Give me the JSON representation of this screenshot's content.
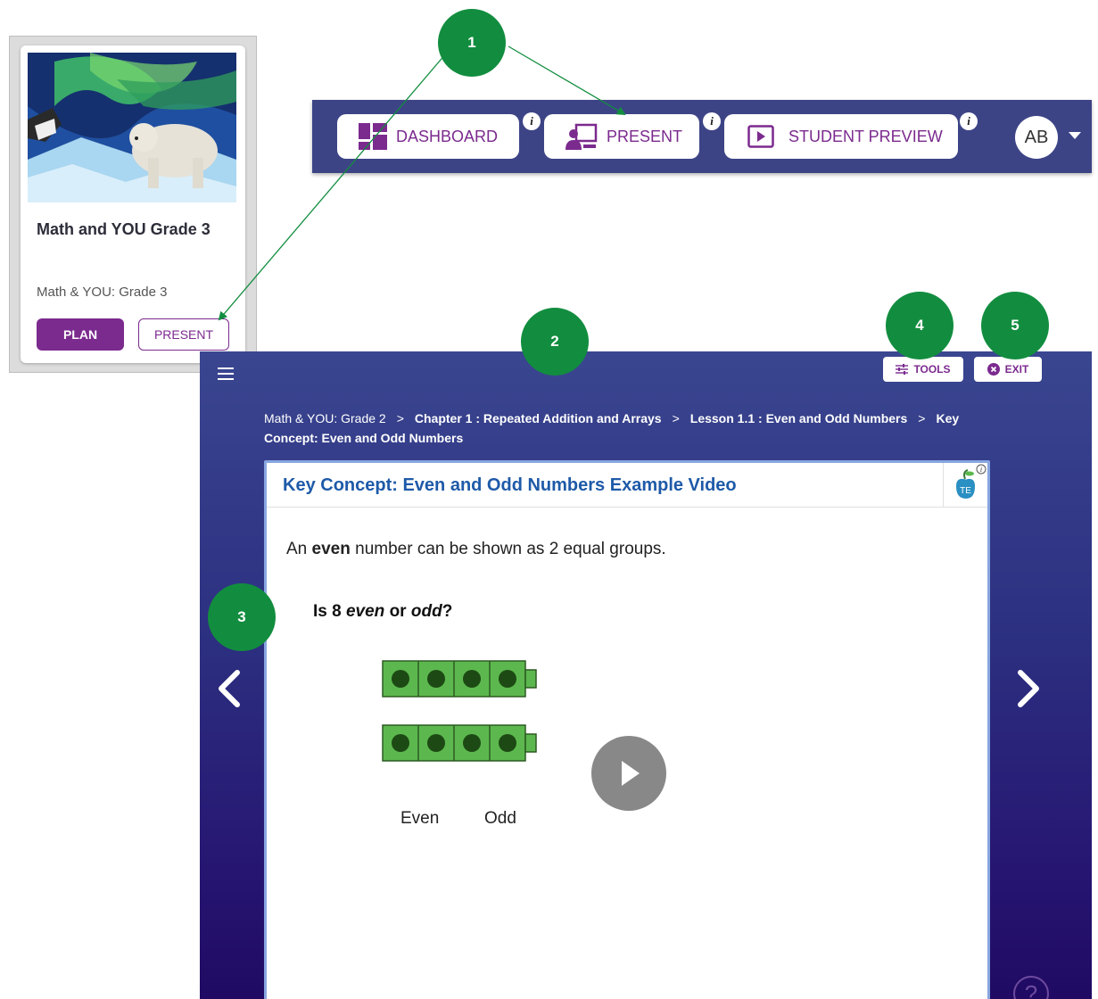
{
  "card": {
    "title": "Math and YOU Grade 3",
    "subtitle": "Math & YOU: Grade 3",
    "plan_label": "PLAN",
    "present_label": "PRESENT"
  },
  "navbar": {
    "dashboard_label": "DASHBOARD",
    "present_label": "PRESENT",
    "student_preview_label": "STUDENT PREVIEW",
    "info_glyph": "i",
    "avatar_initials": "AB"
  },
  "presenter": {
    "tools_label": "TOOLS",
    "exit_label": "EXIT",
    "breadcrumb": {
      "crumb1": "Math & YOU: Grade 2",
      "crumb2": "Chapter 1 : Repeated Addition and Arrays",
      "crumb3": "Lesson 1.1 : Even and Odd Numbers",
      "crumb4": "Key Concept: Even and Odd Numbers",
      "separator": ">"
    },
    "content": {
      "title": "Key Concept: Even and Odd Numbers Example Video",
      "te_label": "TE",
      "text_pre": "An ",
      "text_bold": "even",
      "text_post": " number can be shown as 2 equal groups.",
      "q_pre": "Is 8 ",
      "q_even": "even",
      "q_mid": " or ",
      "q_odd": "odd",
      "q_post": "?",
      "even_label": "Even",
      "odd_label": "Odd"
    },
    "help_glyph": "?"
  },
  "callouts": [
    "1",
    "2",
    "3",
    "4",
    "5"
  ],
  "colors": {
    "accent_purple": "#7b2a8e",
    "navbar_bg": "#3d4486",
    "callout_green": "#128d3f",
    "cube_green": "#5cb84e",
    "title_blue": "#1e5aa8"
  }
}
